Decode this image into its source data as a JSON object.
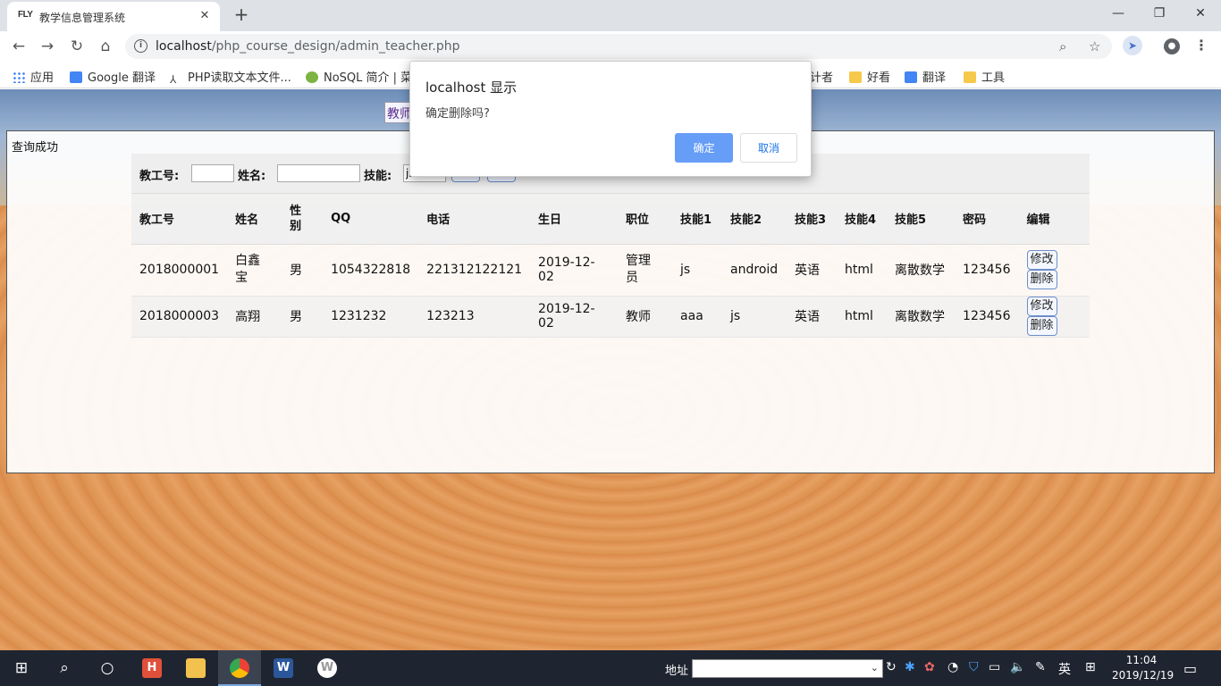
{
  "browser": {
    "tab_favicon": "FLY",
    "tab_title": "教学信息管理系统",
    "url_host": "localhost",
    "url_path": "/php_course_design/admin_teacher.php"
  },
  "bookmarks": [
    {
      "label": "应用",
      "icon": "apps-icon"
    },
    {
      "label": "Google 翻译",
      "icon": "google-translate-icon"
    },
    {
      "label": "PHP读取文本文件...",
      "icon": "php-icon"
    },
    {
      "label": "NoSQL 简介 | 菜",
      "icon": "nosql-icon"
    },
    {
      "label": "计者",
      "icon": "folder-icon"
    },
    {
      "label": "好看",
      "icon": "folder-icon"
    },
    {
      "label": "翻译",
      "icon": "translate-icon"
    },
    {
      "label": "工具",
      "icon": "folder-icon"
    }
  ],
  "page": {
    "nav_tab": "教师",
    "status": "查询成功",
    "search": {
      "id_label": "教工号:",
      "name_label": "姓名:",
      "skill_label": "技能:",
      "skill_value": "js"
    },
    "table": {
      "headers": [
        "教工号",
        "姓名",
        "性别",
        "QQ",
        "电话",
        "生日",
        "职位",
        "技能1",
        "技能2",
        "技能3",
        "技能4",
        "技能5",
        "密码",
        "编辑"
      ],
      "rows": [
        [
          "2018000001",
          "白鑫宝",
          "男",
          "1054322818",
          "221312122121",
          "2019-12-02",
          "管理员",
          "js",
          "android",
          "英语",
          "html",
          "离散数学",
          "123456"
        ],
        [
          "2018000003",
          "高翔",
          "男",
          "1231232",
          "123213",
          "2019-12-02",
          "教师",
          "aaa",
          "js",
          "英语",
          "html",
          "离散数学",
          "123456"
        ]
      ],
      "edit_label": "修改",
      "delete_label": "删除"
    }
  },
  "dialog": {
    "title": "localhost 显示",
    "message": "确定删除吗?",
    "ok_label": "确定",
    "cancel_label": "取消",
    "ok_color": "#669df6"
  },
  "taskbar": {
    "address_label": "地址",
    "ime": "英",
    "time": "11:04",
    "date": "2019/12/19"
  }
}
